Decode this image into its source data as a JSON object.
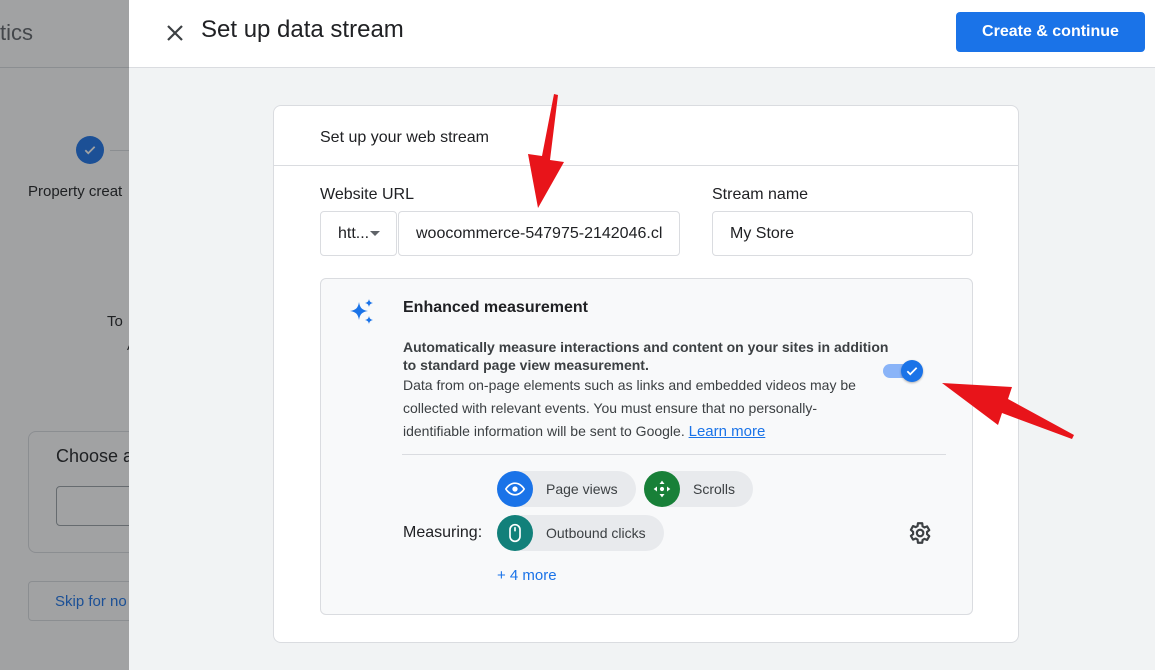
{
  "background": {
    "brand_fragment": "tics",
    "step_label": "Property creat",
    "to_text": "To",
    "a_text": "A",
    "choose_label": "Choose a",
    "skip_label": "Skip for no"
  },
  "dialog": {
    "title": "Set up data stream",
    "primary_button": "Create & continue",
    "card": {
      "title": "Set up your web stream",
      "website_url_label": "Website URL",
      "protocol_value": "htt...",
      "url_value": "woocommerce-547975-2142046.cl",
      "stream_name_label": "Stream name",
      "stream_name_value": "My Store"
    },
    "enhanced": {
      "title": "Enhanced measurement",
      "bold_text": "Automatically measure interactions and content on your sites in addition to standard page view measurement.",
      "desc_text": "Data from on-page elements such as links and embedded videos may be collected with relevant events. You must ensure that no personally-identifiable information will be sent to Google.",
      "learn_more": "Learn more",
      "toggle_on": true,
      "measuring_label": "Measuring:",
      "chips": [
        {
          "label": "Page views",
          "icon": "eye-icon",
          "color": "#1a73e8"
        },
        {
          "label": "Scrolls",
          "icon": "scroll-arrows-icon",
          "color": "#188038"
        },
        {
          "label": "Outbound clicks",
          "icon": "mouse-icon",
          "color": "#12807a"
        }
      ],
      "more_link": "+ 4 more"
    }
  },
  "colors": {
    "accent": "#1a73e8",
    "annotation_arrow": "#e8141a"
  }
}
